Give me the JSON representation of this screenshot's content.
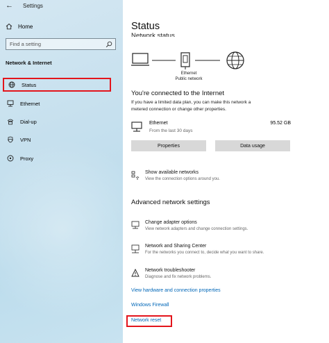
{
  "window": {
    "title": "Settings",
    "back_glyph": "←"
  },
  "sidebar": {
    "home_label": "Home",
    "search_placeholder": "Find a setting",
    "section_title": "Network & Internet",
    "items": [
      {
        "label": "Status",
        "icon": "globe-icon",
        "active": true
      },
      {
        "label": "Ethernet",
        "icon": "ethernet-icon",
        "active": false
      },
      {
        "label": "Dial-up",
        "icon": "dialup-icon",
        "active": false
      },
      {
        "label": "VPN",
        "icon": "vpn-icon",
        "active": false
      },
      {
        "label": "Proxy",
        "icon": "proxy-icon",
        "active": false
      }
    ]
  },
  "main": {
    "title": "Status",
    "subtitle_cut": "Network status",
    "diagram_label_line1": "Ethernet",
    "diagram_label_line2": "Public network",
    "connected_heading": "You're connected to the Internet",
    "connected_text_1": "If you have a limited data plan, you can make this network a",
    "connected_text_2": "metered connection or change other properties.",
    "ethernet": {
      "name": "Ethernet",
      "since": "From the last 30 days",
      "usage": "95.52 GB"
    },
    "buttons": {
      "properties": "Properties",
      "data_usage": "Data usage"
    },
    "show_networks": {
      "title": "Show available networks",
      "desc": "View the connection options around you."
    },
    "advanced_heading": "Advanced network settings",
    "options": [
      {
        "title": "Change adapter options",
        "desc": "View network adapters and change connection settings.",
        "icon": "adapter-icon"
      },
      {
        "title": "Network and Sharing Center",
        "desc": "For the networks you connect to, decide what you want to share.",
        "icon": "sharing-icon"
      },
      {
        "title": "Network troubleshooter",
        "desc": "Diagnose and fix network problems.",
        "icon": "warning-icon"
      }
    ],
    "links": {
      "hardware": "View hardware and connection properties",
      "firewall": "Windows Firewall",
      "reset": "Network reset"
    }
  },
  "colors": {
    "accent_link": "#0067b8",
    "highlight_red": "#e3141b",
    "button_gray": "#d8d8d8"
  }
}
